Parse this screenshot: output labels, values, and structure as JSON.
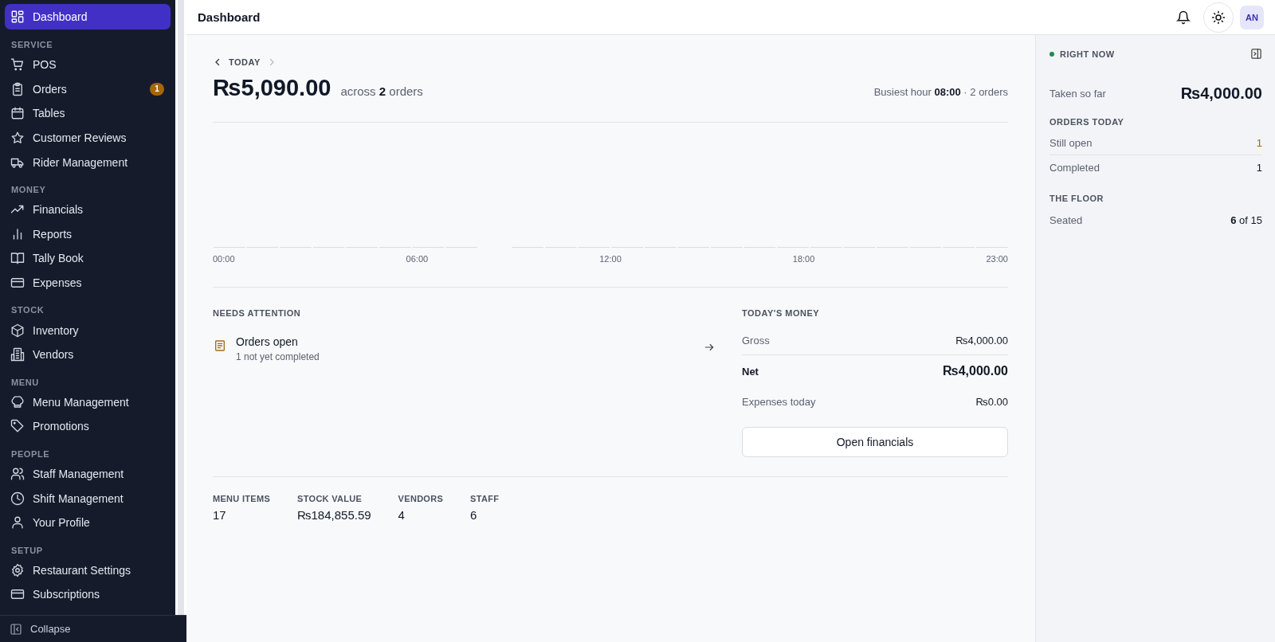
{
  "sidebar": {
    "sections": [
      {
        "items": [
          {
            "label": "Dashboard",
            "selected": true
          }
        ]
      },
      {
        "title": "SERVICE",
        "items": [
          {
            "label": "POS",
            "selected": false
          },
          {
            "label": "Orders",
            "selected": false,
            "badge": "1"
          },
          {
            "label": "Tables",
            "selected": false
          },
          {
            "label": "Customer Reviews",
            "selected": false
          },
          {
            "label": "Rider Management",
            "selected": false
          }
        ]
      },
      {
        "title": "MONEY",
        "items": [
          {
            "label": "Financials",
            "selected": false
          },
          {
            "label": "Reports",
            "selected": false
          },
          {
            "label": "Tally Book",
            "selected": false
          },
          {
            "label": "Expenses",
            "selected": false
          }
        ]
      },
      {
        "title": "STOCK",
        "items": [
          {
            "label": "Inventory",
            "selected": false
          },
          {
            "label": "Vendors",
            "selected": false
          }
        ]
      },
      {
        "title": "MENU",
        "items": [
          {
            "label": "Menu Management",
            "selected": false
          },
          {
            "label": "Promotions",
            "selected": false
          }
        ]
      },
      {
        "title": "PEOPLE",
        "items": [
          {
            "label": "Staff Management",
            "selected": false
          },
          {
            "label": "Shift Management",
            "selected": false
          },
          {
            "label": "Your Profile",
            "selected": false
          }
        ]
      },
      {
        "title": "SETUP",
        "items": [
          {
            "label": "Restaurant Settings",
            "selected": false
          },
          {
            "label": "Subscriptions",
            "selected": false
          }
        ]
      }
    ],
    "collapse": "Collapse"
  },
  "header": {
    "title": "Dashboard",
    "avatar": "AN"
  },
  "summary": {
    "period": "TODAY",
    "total": "₨5,090.00",
    "orders_text": "across **2** orders",
    "busiest": "Busiest hour **08:00** · 2 orders"
  },
  "chart": {
    "x_labels": [
      "00:00",
      "06:00",
      "12:00",
      "18:00",
      "23:00"
    ]
  },
  "attention": {
    "title": "NEEDS ATTENTION",
    "items": [
      {
        "title": "Orders open",
        "subtitle": "1 not yet completed"
      }
    ]
  },
  "money": {
    "title": "TODAY'S MONEY",
    "rows": [
      {
        "label": "Gross",
        "value": "₨4,000.00",
        "kind": "normal"
      },
      {
        "label": "Net",
        "value": "₨4,000.00",
        "kind": "strong"
      },
      {
        "label": "Expenses today",
        "value": "₨0.00",
        "kind": "plain"
      }
    ],
    "button": "Open financials"
  },
  "stats": [
    {
      "label": "MENU ITEMS",
      "value": "17"
    },
    {
      "label": "STOCK VALUE",
      "value": "₨184,855.59"
    },
    {
      "label": "VENDORS",
      "value": "4"
    },
    {
      "label": "STAFF",
      "value": "6"
    }
  ],
  "right_now": {
    "title": "RIGHT NOW",
    "taken_label": "Taken so far",
    "taken_value": "₨4,000.00",
    "groups": [
      {
        "title": "ORDERS TODAY",
        "rows": [
          {
            "label": "Still open",
            "value": "1",
            "kind": "warn"
          },
          {
            "label": "Completed",
            "value": "1",
            "kind": "normal"
          }
        ]
      },
      {
        "title": "THE FLOOR",
        "rows": [
          {
            "label": "Seated",
            "value": "**6** of 15",
            "kind": "normal"
          }
        ]
      }
    ]
  }
}
